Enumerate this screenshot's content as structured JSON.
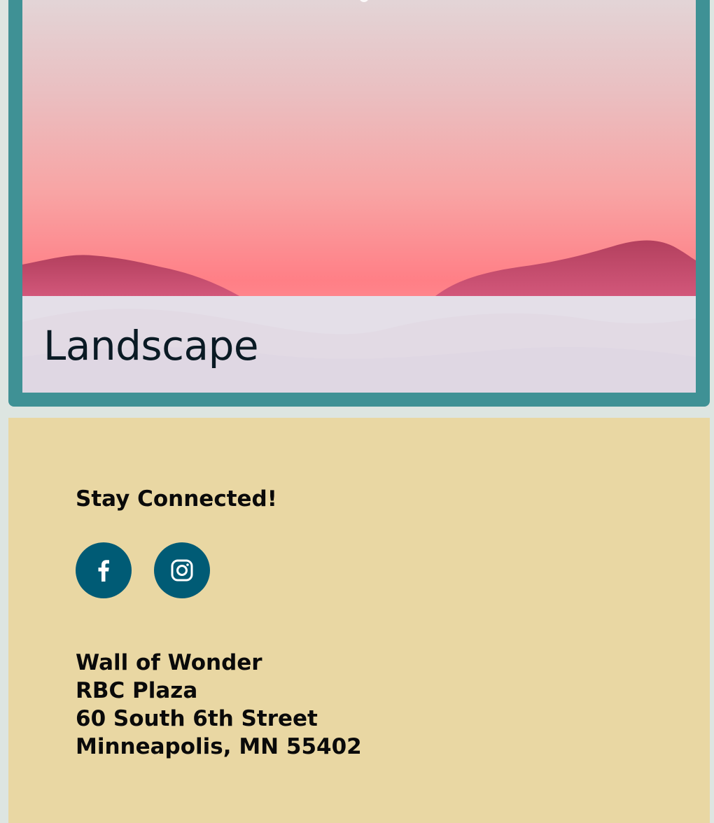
{
  "gallery": {
    "card_title": "Landscape"
  },
  "footer": {
    "heading": "Stay Connected!",
    "social": [
      {
        "icon": "facebook-icon",
        "label": "Facebook"
      },
      {
        "icon": "instagram-icon",
        "label": "Instagram"
      }
    ],
    "address": {
      "line1": "Wall of Wonder",
      "line2": "RBC Plaza",
      "line3": "60 South 6th Street",
      "line4": "Minneapolis, MN 55402"
    }
  },
  "colors": {
    "card_border": "#3f9195",
    "footer_bg": "#e9d7a3",
    "social_bg": "#005b75",
    "page_bg": "#dde5e1"
  }
}
